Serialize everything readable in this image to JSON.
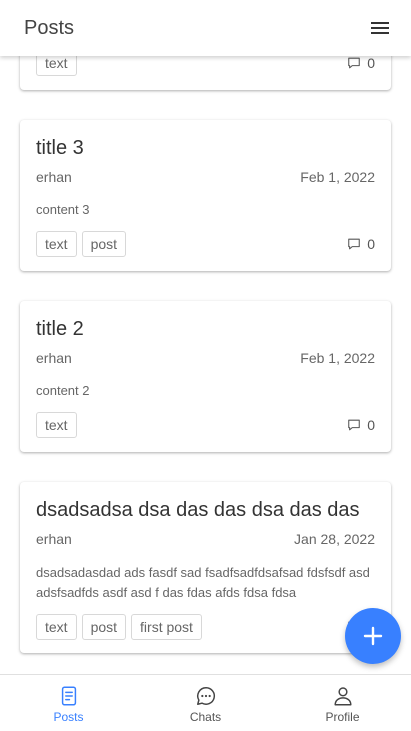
{
  "header": {
    "title": "Posts"
  },
  "colors": {
    "accent": "#3880ff"
  },
  "partial_card": {
    "tags": [
      "text"
    ],
    "comment_count": "0"
  },
  "posts": [
    {
      "title": "title 3",
      "author": "erhan",
      "date": "Feb 1, 2022",
      "content": "content 3",
      "tags": [
        "text",
        "post"
      ],
      "comment_count": "0"
    },
    {
      "title": "title 2",
      "author": "erhan",
      "date": "Feb 1, 2022",
      "content": "content 2",
      "tags": [
        "text"
      ],
      "comment_count": "0"
    },
    {
      "title": "dsadsadsa dsa das das dsa das das",
      "author": "erhan",
      "date": "Jan 28, 2022",
      "content": "dsadsadasdad ads fasdf sad fsadfsadfdsafsad fdsfsdf asd adsfsadfds asdf asd f das fdas afds fdsa fdsa",
      "tags": [
        "text",
        "post",
        "first post"
      ],
      "comment_count": "0"
    }
  ],
  "fab": {
    "icon": "add-icon"
  },
  "tabs": [
    {
      "label": "Posts",
      "icon": "document-icon",
      "active": true
    },
    {
      "label": "Chats",
      "icon": "chat-bubble-icon",
      "active": false
    },
    {
      "label": "Profile",
      "icon": "person-icon",
      "active": false
    }
  ]
}
